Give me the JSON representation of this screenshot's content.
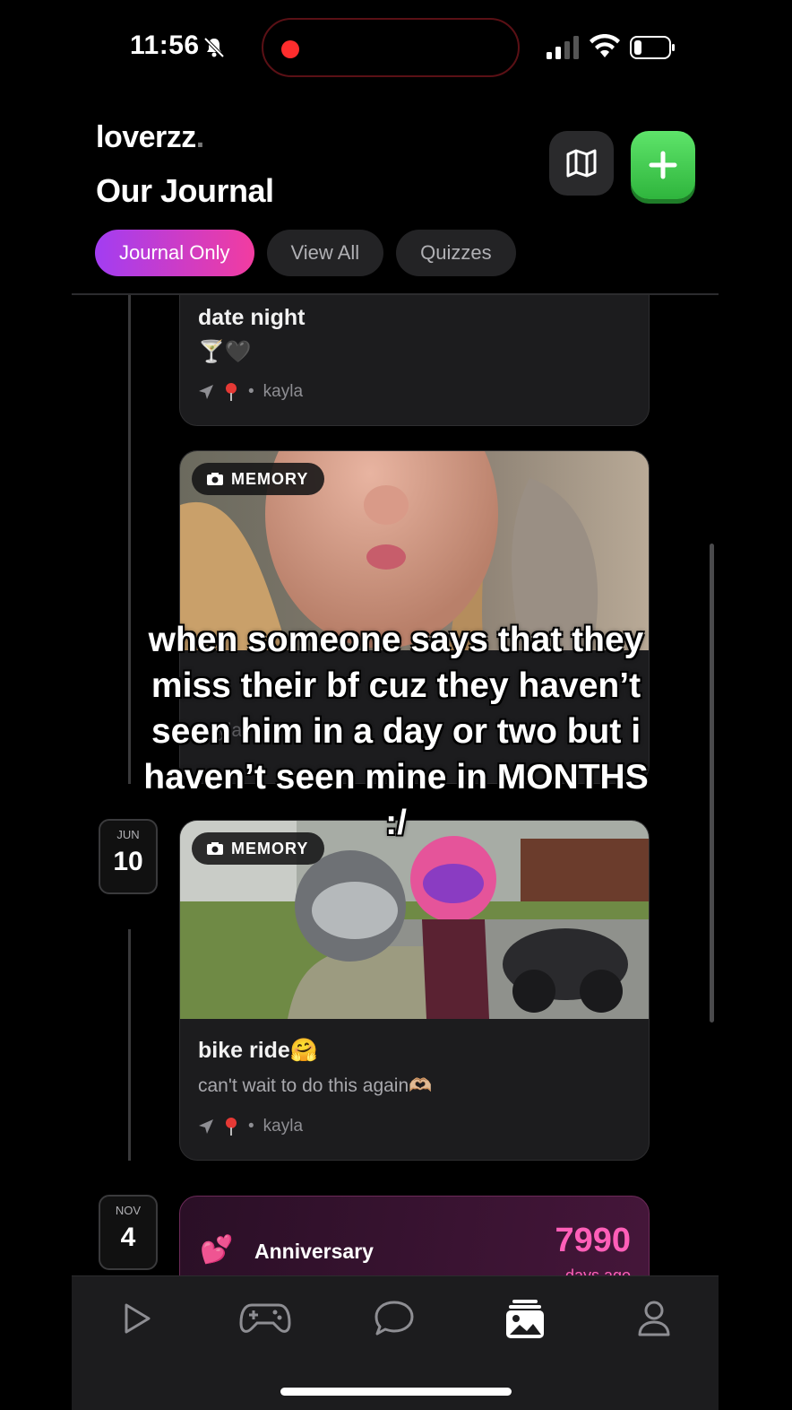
{
  "status_bar": {
    "time": "11:56"
  },
  "header": {
    "app_name": "loverzz",
    "app_dot": ".",
    "title": "Our Journal"
  },
  "tabs": [
    {
      "label": "Journal Only",
      "active": true
    },
    {
      "label": "View All",
      "active": false
    },
    {
      "label": "Quizzes",
      "active": false
    }
  ],
  "entries": [
    {
      "title": "date night",
      "emoji": "🍸🖤",
      "author": "kayla"
    },
    {
      "badge": "MEMORY",
      "author": "kayla"
    },
    {
      "date_month": "JUN",
      "date_day": "10",
      "badge": "MEMORY",
      "title": "bike ride🤗",
      "body": "can't wait to do this again🫶🏼",
      "author": "kayla"
    }
  ],
  "anniversary": {
    "date_month": "NOV",
    "date_day": "4",
    "emoji": "💕",
    "label": "Anniversary",
    "count": "7990",
    "unit": "days ago"
  },
  "caption": "when someone says that they miss their bf cuz they haven’t seen him in a day or two but i haven’t seen mine in MONTHS :/",
  "colors": {
    "accent_gradient_start": "#a23df2",
    "accent_gradient_end": "#f23ca0",
    "add_button": "#34c759",
    "anniversary_count": "#ff5fb8"
  },
  "tab_bar": [
    "play-icon",
    "gamepad-icon",
    "chat-icon",
    "journal-photos-icon",
    "profile-icon"
  ]
}
